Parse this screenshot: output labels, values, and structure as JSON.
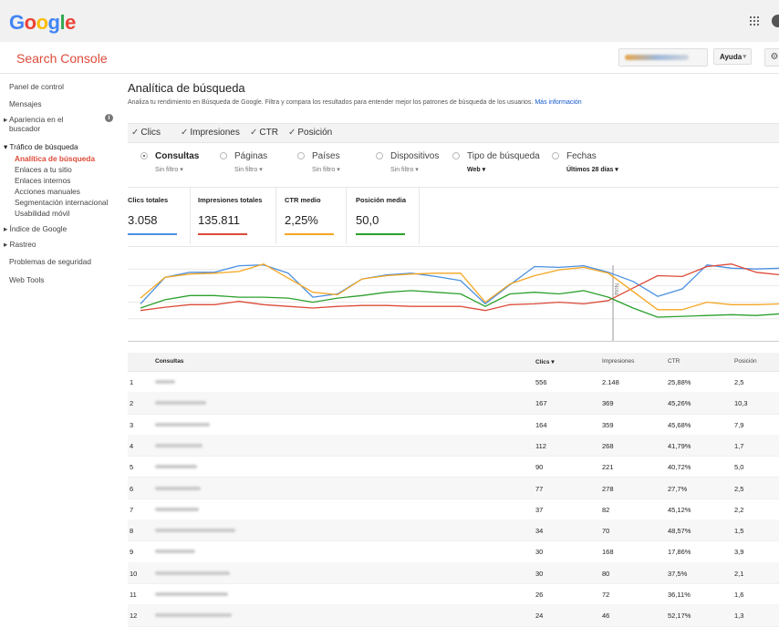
{
  "header": {
    "logo_letters": [
      {
        "ch": "G",
        "color": "#4285f4"
      },
      {
        "ch": "o",
        "color": "#ea4335"
      },
      {
        "ch": "o",
        "color": "#fbbc05"
      },
      {
        "ch": "g",
        "color": "#4285f4"
      },
      {
        "ch": "l",
        "color": "#34a853"
      },
      {
        "ch": "e",
        "color": "#ea4335"
      }
    ],
    "apps_icon": "apps-grid-icon",
    "account_icon": "account-icon"
  },
  "subheader": {
    "title": "Search Console",
    "help_label": "Ayuda",
    "help_caret": "▾",
    "settings_icon": "gear-icon"
  },
  "sidebar": {
    "items": [
      {
        "label": "Panel de control"
      },
      {
        "label": "Mensajes"
      },
      {
        "label": "▸ Apariencia en el"
      },
      {
        "label": "buscador"
      },
      {
        "label": "▾ Tráfico de búsqueda"
      },
      {
        "label": "Analítica de búsqueda"
      },
      {
        "label": "Enlaces a tu sitio"
      },
      {
        "label": "Enlaces internos"
      },
      {
        "label": "Acciones manuales"
      },
      {
        "label": "Segmentación internacional"
      },
      {
        "label": "Usabilidad móvil"
      },
      {
        "label": "▸ Índice de Google"
      },
      {
        "label": "▸ Rastreo"
      },
      {
        "label": "Problemas de seguridad"
      },
      {
        "label": "Web Tools"
      }
    ],
    "info_glyph": "i"
  },
  "main": {
    "title": "Analítica de búsqueda",
    "description": "Analiza tu rendimiento en Búsqueda de Google. Filtra y compara los resultados para entender mejor los patrones de búsqueda de los usuarios.",
    "more_info": "Más información"
  },
  "checks": [
    {
      "label": "Clics"
    },
    {
      "label": "Impresiones"
    },
    {
      "label": "CTR"
    },
    {
      "label": "Posición"
    }
  ],
  "check_mark": "✓",
  "dimensions": [
    {
      "name": "Consultas",
      "sub": "Sin filtro ▾"
    },
    {
      "name": "Páginas",
      "sub": "Sin filtro ▾"
    },
    {
      "name": "Países",
      "sub": "Sin filtro ▾"
    },
    {
      "name": "Dispositivos",
      "sub": "Sin filtro ▾"
    },
    {
      "name": "Tipo de búsqueda",
      "sub": "Web ▾"
    },
    {
      "name": "Fechas",
      "sub": "Últimos 28 días ▾"
    }
  ],
  "metrics": [
    {
      "label": "Clics totales",
      "value": "3.058",
      "color": "#4a90e2"
    },
    {
      "label": "Impresiones totales",
      "value": "135.811",
      "color": "#dd4b39"
    },
    {
      "label": "CTR medio",
      "value": "2,25%",
      "color": "#f5a623"
    },
    {
      "label": "Posición media",
      "value": "50,0",
      "color": "#2ca02c"
    }
  ],
  "chart_data": {
    "type": "line",
    "annotation": "Nota",
    "series": [
      {
        "color": "#4a90e2",
        "values": [
          38,
          70,
          76,
          76,
          84,
          85,
          75,
          46,
          50,
          68,
          73,
          75,
          71,
          66,
          38,
          61,
          83,
          82,
          84,
          76,
          65,
          47,
          56,
          85,
          81,
          80,
          81
        ]
      },
      {
        "color": "#dd4b39",
        "values": [
          30,
          34,
          37,
          37,
          41,
          37,
          35,
          33,
          35,
          36,
          36,
          35,
          35,
          35,
          30,
          37,
          38,
          40,
          38,
          42,
          57,
          72,
          71,
          83,
          86,
          76,
          73
        ]
      },
      {
        "color": "#f5a623",
        "values": [
          45,
          70,
          74,
          75,
          77,
          86,
          69,
          52,
          49,
          68,
          72,
          74,
          75,
          75,
          40,
          62,
          72,
          79,
          82,
          75,
          53,
          31,
          31,
          40,
          37,
          37,
          38
        ]
      },
      {
        "color": "#2ca02c",
        "values": [
          33,
          43,
          48,
          48,
          46,
          46,
          45,
          40,
          45,
          48,
          52,
          54,
          52,
          50,
          35,
          50,
          52,
          50,
          54,
          46,
          33,
          22,
          23,
          24,
          25,
          24,
          26
        ]
      }
    ],
    "ylim": [
      0,
      100
    ]
  },
  "table": {
    "headers": {
      "query": "Consultas",
      "clicks": "Clics ▾",
      "impressions": "Impresiones",
      "ctr": "CTR",
      "position": "Posición"
    },
    "rows": [
      {
        "n": "1",
        "clicks": "556",
        "impressions": "2.148",
        "ctr": "25,88%",
        "position": "2,5"
      },
      {
        "n": "2",
        "clicks": "167",
        "impressions": "369",
        "ctr": "45,26%",
        "position": "10,3"
      },
      {
        "n": "3",
        "clicks": "164",
        "impressions": "359",
        "ctr": "45,68%",
        "position": "7,9"
      },
      {
        "n": "4",
        "clicks": "112",
        "impressions": "268",
        "ctr": "41,79%",
        "position": "1,7"
      },
      {
        "n": "5",
        "clicks": "90",
        "impressions": "221",
        "ctr": "40,72%",
        "position": "5,0"
      },
      {
        "n": "6",
        "clicks": "77",
        "impressions": "278",
        "ctr": "27,7%",
        "position": "2,5"
      },
      {
        "n": "7",
        "clicks": "37",
        "impressions": "82",
        "ctr": "45,12%",
        "position": "2,2"
      },
      {
        "n": "8",
        "clicks": "34",
        "impressions": "70",
        "ctr": "48,57%",
        "position": "1,5"
      },
      {
        "n": "9",
        "clicks": "30",
        "impressions": "168",
        "ctr": "17,86%",
        "position": "3,9"
      },
      {
        "n": "10",
        "clicks": "30",
        "impressions": "80",
        "ctr": "37,5%",
        "position": "2,1"
      },
      {
        "n": "11",
        "clicks": "26",
        "impressions": "72",
        "ctr": "36,11%",
        "position": "1,6"
      },
      {
        "n": "12",
        "clicks": "24",
        "impressions": "46",
        "ctr": "52,17%",
        "position": "1,3"
      }
    ]
  }
}
